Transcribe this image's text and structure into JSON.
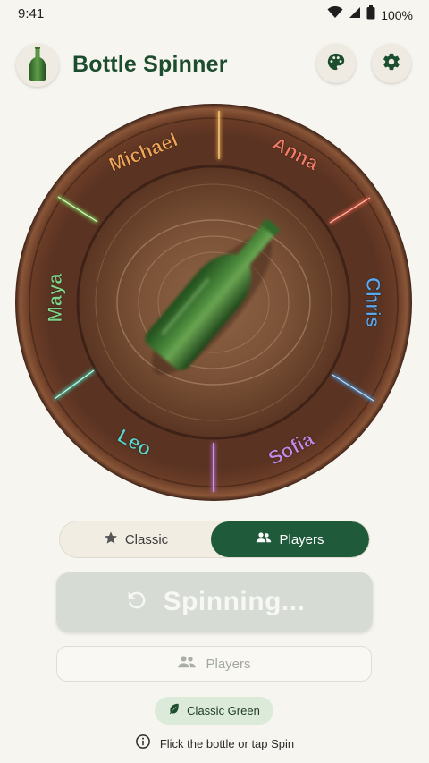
{
  "status": {
    "time": "9:41",
    "battery": "100%",
    "icons": [
      "wifi-icon",
      "signal-icon",
      "battery-icon"
    ]
  },
  "app": {
    "title": "Bottle Spinner",
    "logo_icon": "bottle-icon",
    "actions": [
      {
        "name": "palette",
        "icon": "palette-icon"
      },
      {
        "name": "settings",
        "icon": "gear-icon"
      }
    ]
  },
  "wheel": {
    "players": [
      {
        "name": "Michael",
        "color": "#f0a65a"
      },
      {
        "name": "Anna",
        "color": "#ef7b68"
      },
      {
        "name": "Chris",
        "color": "#5aa8f0"
      },
      {
        "name": "Sofia",
        "color": "#c48ae8"
      },
      {
        "name": "Leo",
        "color": "#5ad7cf"
      },
      {
        "name": "Maya",
        "color": "#7fd38a"
      }
    ],
    "divider_colors": [
      "#ffb24a",
      "#ff5d4a",
      "#3fa4ff",
      "#c06cff",
      "#3ee0c0",
      "#7bea5a"
    ],
    "bottle_color": "#3e7a34"
  },
  "mode": {
    "options": [
      {
        "label": "Classic",
        "icon": "star-icon",
        "selected": false
      },
      {
        "label": "Players",
        "icon": "people-icon",
        "selected": true
      }
    ]
  },
  "spin": {
    "label": "Spinning...",
    "icon": "refresh-icon",
    "disabled": true
  },
  "players_button": {
    "label": "Players",
    "icon": "people-icon"
  },
  "theme": {
    "label": "Classic Green",
    "icon": "leaf-icon"
  },
  "hint": {
    "text": "Flick the bottle or tap Spin",
    "icon": "info-icon"
  }
}
